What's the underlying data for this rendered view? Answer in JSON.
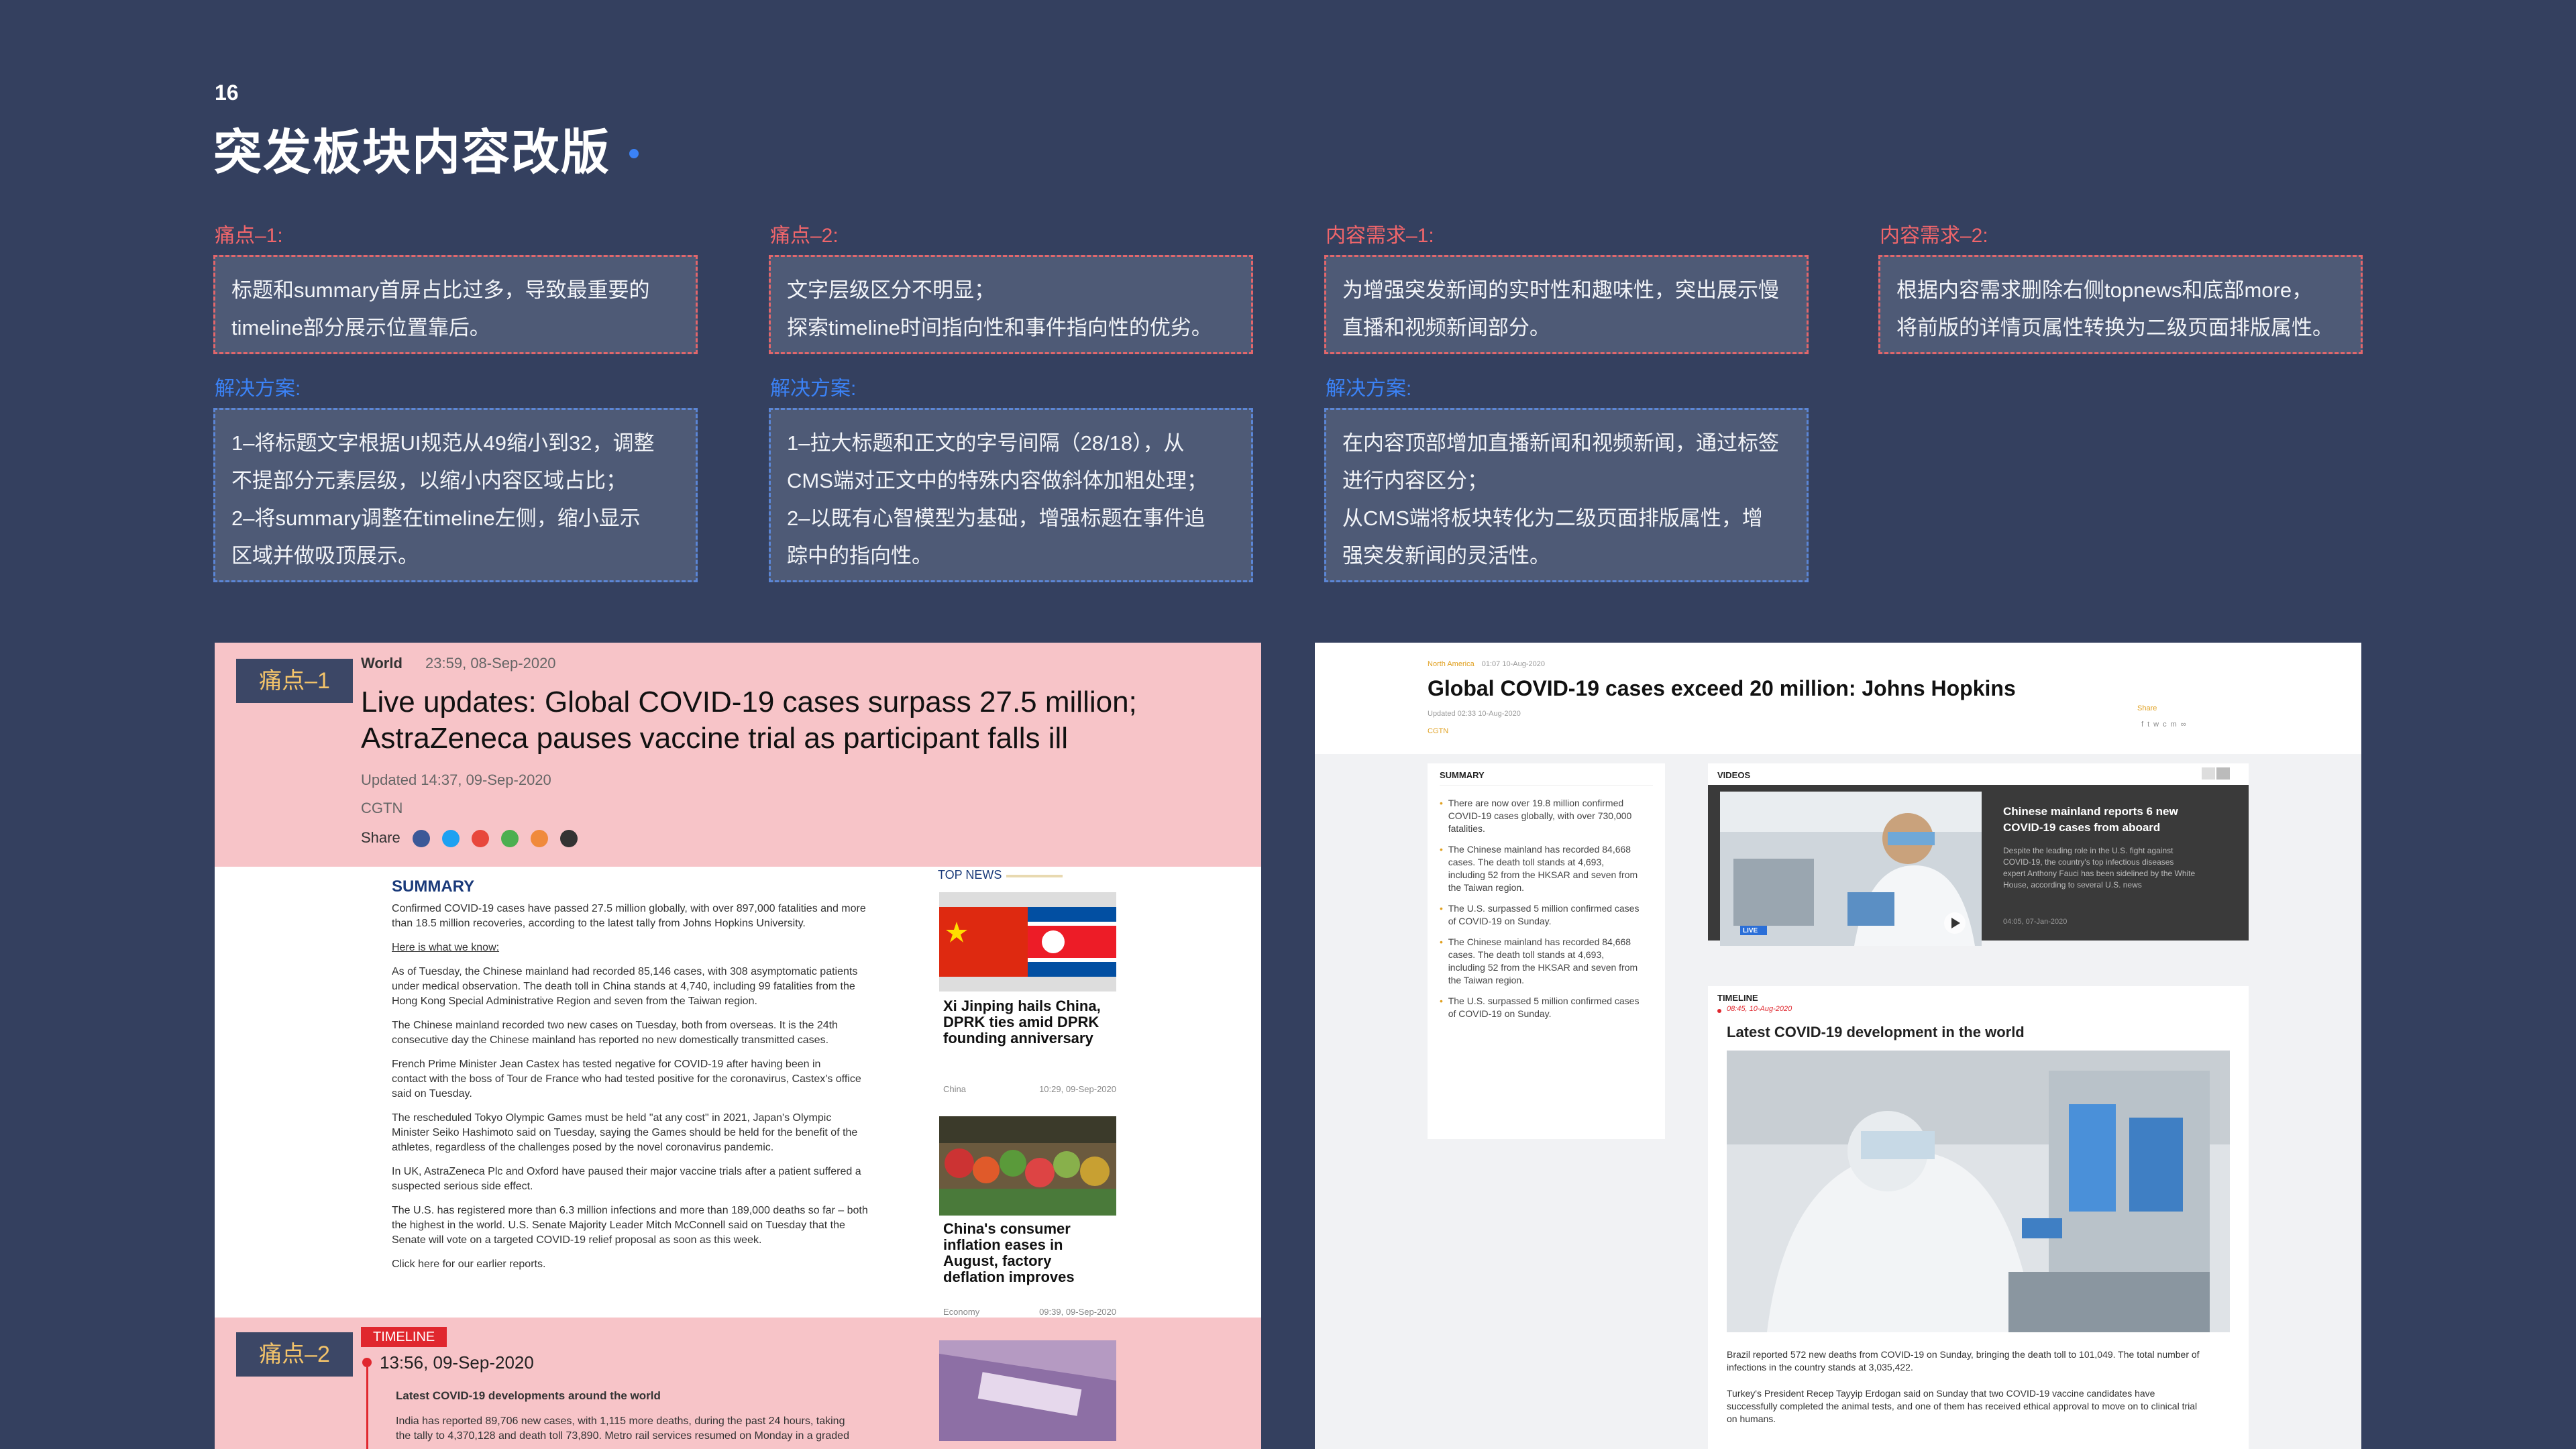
{
  "page": {
    "number": "16",
    "title": "突发板块内容改版"
  },
  "columns": [
    {
      "pain_label": "痛点–1:",
      "pain_text": [
        "标题和summary首屏占比过多，导致最重要的",
        "timeline部分展示位置靠后。"
      ],
      "solution_label": "解决方案:",
      "solution_text": [
        "1–将标题文字根据UI规范从49缩小到32，调整",
        "不提部分元素层级，以缩小内容区域占比；",
        "2–将summary调整在timeline左侧，缩小显示",
        "区域并做吸顶展示。"
      ]
    },
    {
      "pain_label": "痛点–2:",
      "pain_text": [
        "文字层级区分不明显；",
        "探索timeline时间指向性和事件指向性的优劣。"
      ],
      "solution_label": "解决方案:",
      "solution_text": [
        "1–拉大标题和正文的字号间隔（28/18），从",
        "CMS端对正文中的特殊内容做斜体加粗处理；",
        "2–以既有心智模型为基础，增强标题在事件追",
        "踪中的指向性。"
      ]
    },
    {
      "pain_label": "内容需求–1:",
      "pain_text": [
        "为增强突发新闻的实时性和趣味性，突出展示慢",
        "直播和视频新闻部分。"
      ],
      "solution_label": "解决方案:",
      "solution_text": [
        "在内容顶部增加直播新闻和视频新闻，通过标签",
        "进行内容区分；",
        "从CMS端将板块转化为二级页面排版属性，增",
        "强突发新闻的灵活性。"
      ]
    },
    {
      "pain_label": "内容需求–2:",
      "pain_text": [
        "根据内容需求删除右侧topnews和底部more，",
        "将前版的详情页属性转换为二级页面排版属性。"
      ]
    }
  ],
  "left_panel": {
    "tag1": "痛点–1",
    "tag2": "痛点–2",
    "section": "World",
    "datetime": "23:59, 08-Sep-2020",
    "headline_l1": "Live updates: Global COVID-19 cases surpass 27.5 million;",
    "headline_l2": "AstraZeneca pauses vaccine trial as participant falls ill",
    "updated": "Updated 14:37, 09-Sep-2020",
    "source": "CGTN",
    "share": "Share",
    "share_colors": [
      "#3b5998",
      "#1da1f2",
      "#e8473c",
      "#4caf50",
      "#f08a3c",
      "#333333"
    ],
    "summary_title": "SUMMARY",
    "summary_lines": [
      "Confirmed COVID-19 cases have passed 27.5 million globally, with over 897,000 fatalities and more",
      "than 18.5 million recoveries, according to the latest tally from Johns Hopkins University."
    ],
    "here_is": "Here is what we know:",
    "paragraphs": [
      [
        "As of Tuesday, the Chinese mainland had recorded 85,146 cases, with 308 asymptomatic patients",
        "under medical observation. The death toll in China stands at 4,740, including 99 fatalities from the",
        "Hong Kong Special Administrative Region and seven from the Taiwan region."
      ],
      [
        "The Chinese mainland recorded two new cases on Tuesday, both from overseas. It is the 24th",
        "consecutive day the Chinese mainland has reported no new domestically transmitted cases."
      ],
      [
        "French Prime Minister Jean Castex has tested negative for COVID-19 after having been in",
        "contact with the boss of Tour de France who had tested positive for the coronavirus, Castex's office",
        "said on Tuesday."
      ],
      [
        "The rescheduled Tokyo Olympic Games must be held \"at any cost\" in 2021, Japan's Olympic",
        "Minister Seiko Hashimoto said on Tuesday, saying the Games should be held for the benefit of the",
        "athletes, regardless of the challenges posed by the novel coronavirus pandemic."
      ],
      [
        "In UK, AstraZeneca Plc and Oxford have paused their major vaccine trials after a patient suffered a",
        "suspected serious side effect."
      ],
      [
        "The U.S. has registered more than 6.3 million infections and more than 189,000 deaths so far – both",
        "the highest in the world. U.S. Senate Majority Leader Mitch McConnell said on Tuesday that the",
        "Senate will vote on a targeted COVID-19 relief proposal as soon as this week."
      ],
      [
        "Click here for our earlier reports."
      ]
    ],
    "top_news": "TOP NEWS",
    "news": [
      {
        "title": [
          "Xi Jinping hails China,",
          "DPRK ties amid DPRK",
          "founding anniversary"
        ],
        "category": "China",
        "time": "10:29, 09-Sep-2020"
      },
      {
        "title": [
          "China's consumer",
          "inflation eases in",
          "August, factory",
          "deflation improves"
        ],
        "category": "Economy",
        "time": "09:39, 09-Sep-2020"
      }
    ],
    "timeline_label": "TIMELINE",
    "timeline_time": "13:56, 09-Sep-2020",
    "timeline_headline": "Latest COVID-19 developments around the world",
    "timeline_lines": [
      "India has reported 89,706 new cases, with 1,115 more deaths, during the past 24 hours, taking",
      "the tally to 4,370,128 and death toll 73,890. Metro rail services resumed on Monday in a graded"
    ]
  },
  "right_panel": {
    "crumb": "North America",
    "crumb_time": "01:07 10-Aug-2020",
    "headline": "Global COVID-19 cases exceed 20 million: Johns Hopkins",
    "updated": "Updated 02:33 10-Aug-2020",
    "source": "CGTN",
    "share": "Share",
    "summary_label": "SUMMARY",
    "summary_bullets": [
      [
        "There are now over 19.8 million confirmed",
        "COVID-19 cases globally, with over 730,000",
        "fatalities."
      ],
      [
        "The Chinese mainland has recorded 84,668",
        "cases. The death toll stands at 4,693,",
        "including 52 from the HKSAR and seven from",
        "the Taiwan region."
      ],
      [
        "The U.S. surpassed 5 million confirmed cases",
        "of COVID-19 on Sunday."
      ],
      [
        "The Chinese mainland has recorded 84,668",
        "cases. The death toll stands at 4,693,",
        "including 52 from the HKSAR and seven from",
        "the Taiwan region."
      ],
      [
        "The U.S. surpassed 5 million confirmed cases",
        "of COVID-19 on Sunday."
      ]
    ],
    "videos_label": "VIDEOS",
    "video_title": [
      "Chinese mainland reports 6 new",
      "COVID-19 cases from aboard"
    ],
    "video_desc": [
      "Despite the leading role in the U.S. fight against",
      "COVID-19, the country's top infectious diseases",
      "expert Anthony Fauci has been sidelined by the White",
      "House, according to several U.S. news"
    ],
    "video_time": "04:05, 07-Jan-2020",
    "live": "LIVE",
    "timeline_label": "TIMELINE",
    "timeline_time": "08:45, 10-Aug-2020",
    "timeline_headline": "Latest COVID-19 development in the world",
    "para1": [
      "Brazil reported 572 new deaths from COVID-19 on Sunday, bringing the death toll to 101,049. The total number of",
      "infections in the country stands at 3,035,422."
    ],
    "para2": [
      "Turkey's President Recep Tayyip Erdogan said on Sunday that two COVID-19 vaccine candidates have",
      "successfully completed the animal tests, and one of them has received ethical approval to move on to clinical trial",
      "on humans."
    ]
  }
}
